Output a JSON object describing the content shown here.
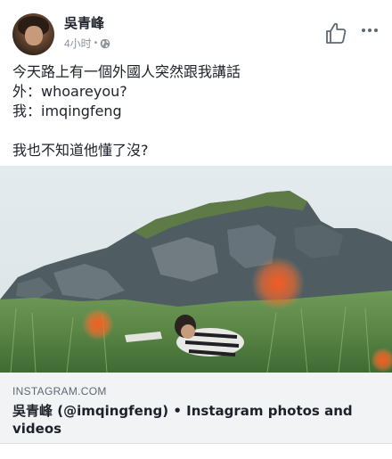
{
  "post": {
    "author": "吳青峰",
    "time": "4小时",
    "separator": "•",
    "privacy_icon": "globe-icon",
    "actions": {
      "like_icon": "thumbs-up-icon",
      "more_icon": "more-horizontal-icon"
    },
    "text_lines": [
      "今天路上有一個外國人突然跟我講話",
      "外：whoareyou?",
      "我：imqingfeng",
      "我也不知道他懂了沒?"
    ]
  },
  "link_preview": {
    "domain": "INSTAGRAM.COM",
    "title": "吳青峰 (@imqingfeng) • Instagram photos and videos"
  },
  "colors": {
    "primary_text": "#1d2129",
    "secondary_text": "#8d949e",
    "card_background": "#f2f3f5"
  }
}
